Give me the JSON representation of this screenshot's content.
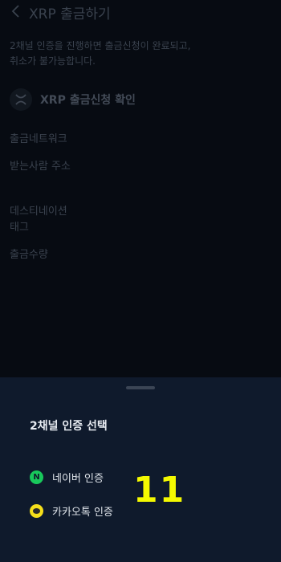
{
  "header": {
    "title": "XRP 출금하기"
  },
  "notice": {
    "line1": "2채널 인증을 진행하면 출금신청이 완료되고,",
    "line2": "취소가 불가능합니다."
  },
  "confirm": {
    "title": "XRP 출금신청 확인",
    "icon": "xrp-icon"
  },
  "fields": {
    "network": "출금네트워크",
    "recipient": "받는사람 주소",
    "destination_line1": "데스티네이션",
    "destination_line2": "태그",
    "amount": "출금수량"
  },
  "sheet": {
    "title": "2채널 인증 선택",
    "options": [
      {
        "label": "네이버 인증",
        "icon": "naver-icon",
        "icon_letter": "N",
        "color": "#18c85b"
      },
      {
        "label": "카카오톡 인증",
        "icon": "kakao-icon",
        "color": "#f5df1b"
      }
    ]
  },
  "overlay": {
    "number": "11"
  },
  "colors": {
    "background": "#070b12",
    "sheet": "#0f1a2c",
    "highlight": "#f4f900"
  }
}
